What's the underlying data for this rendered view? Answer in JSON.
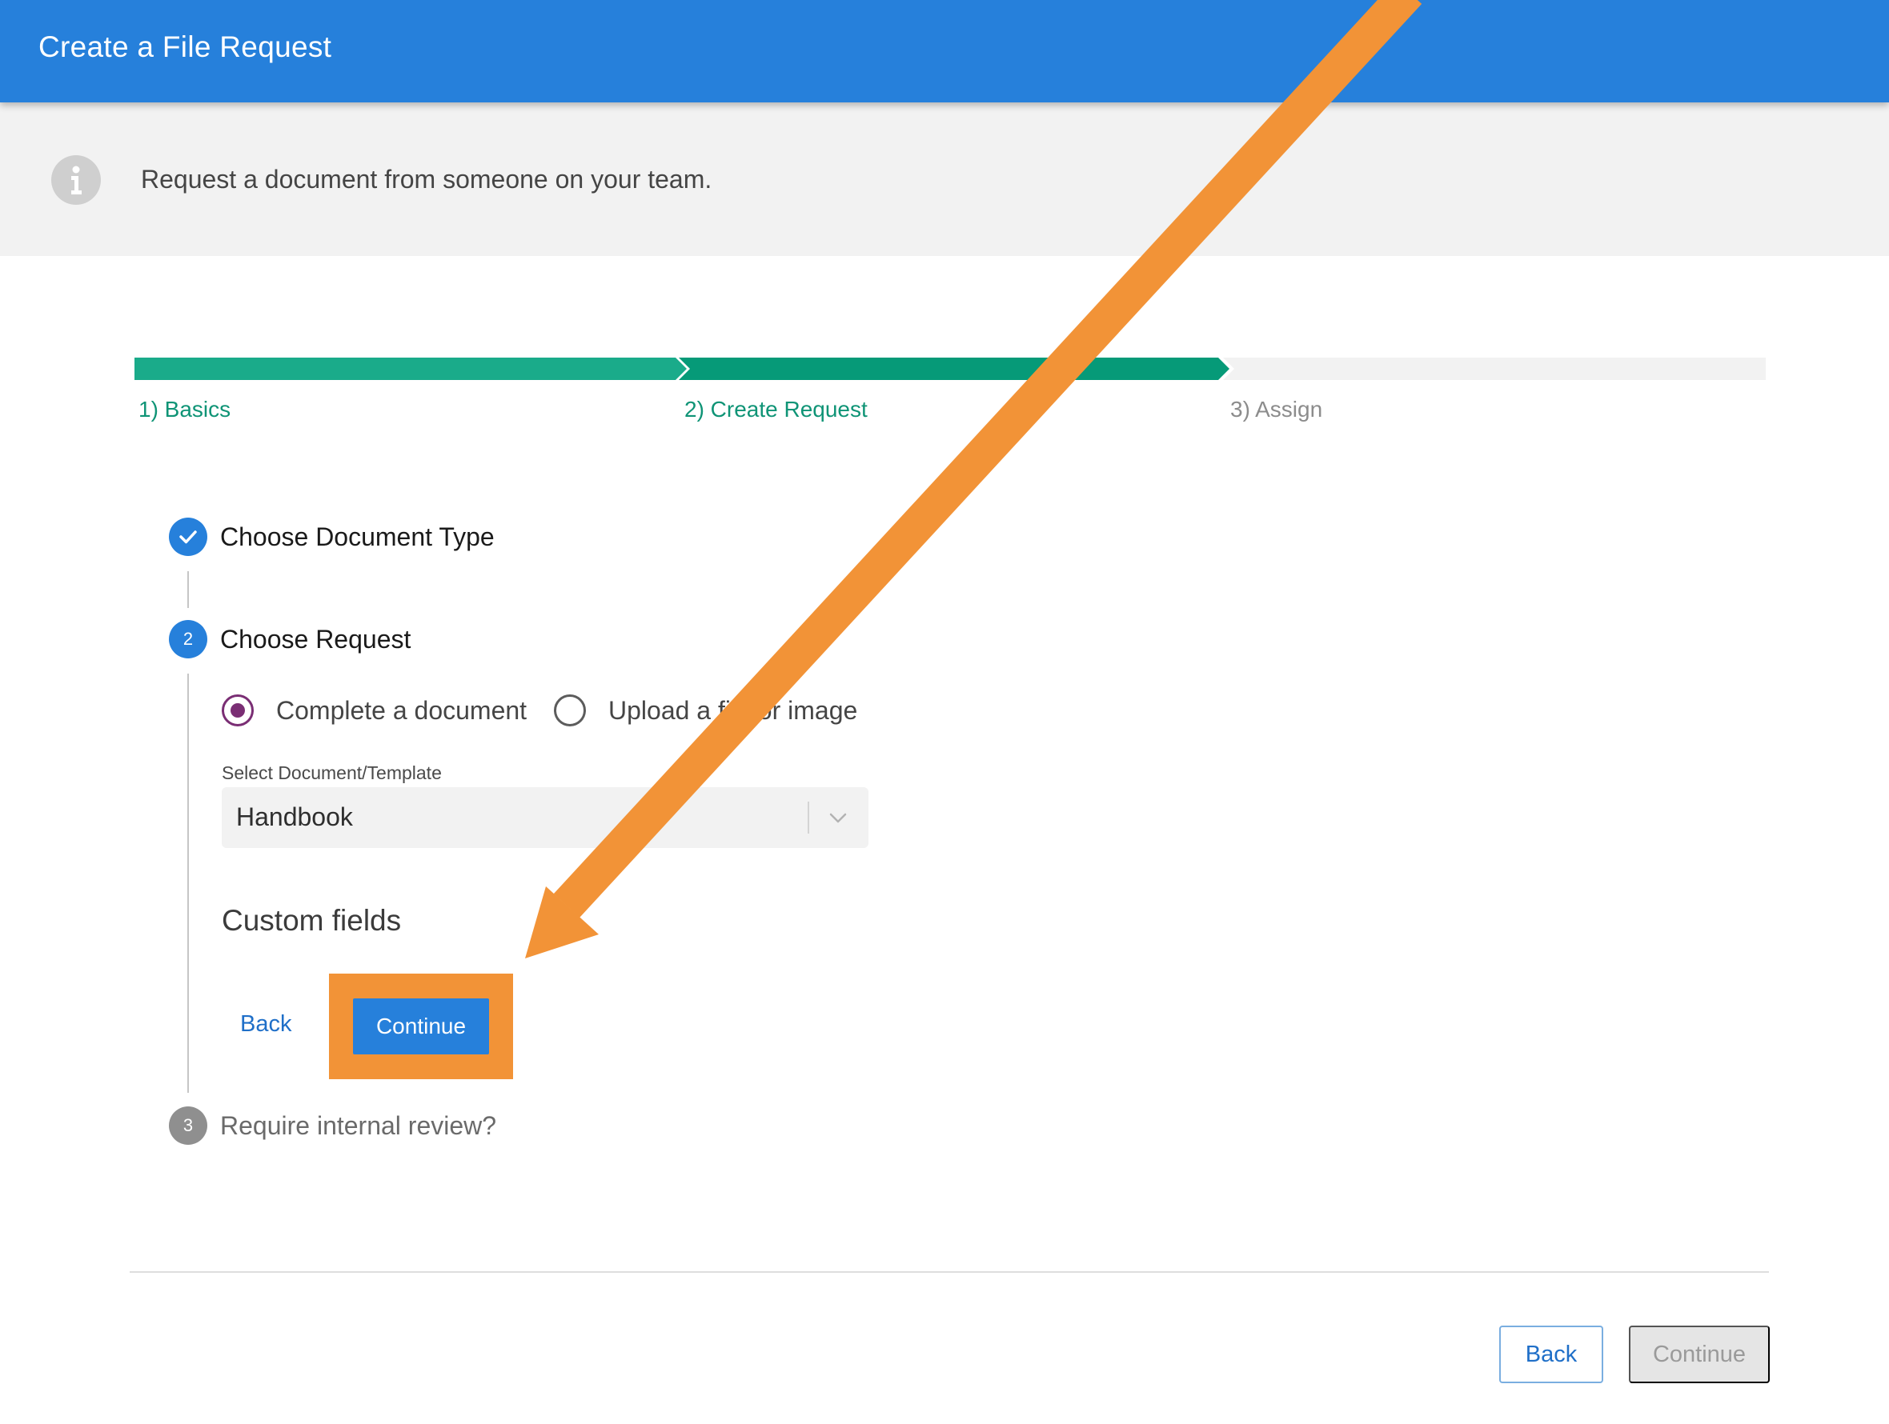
{
  "header": {
    "title": "Create a File Request"
  },
  "banner": {
    "icon": "info-icon",
    "text": "Request a document from someone on your team."
  },
  "progress": {
    "steps": [
      {
        "label": "1) Basics",
        "state": "complete"
      },
      {
        "label": "2) Create Request",
        "state": "current"
      },
      {
        "label": "3) Assign",
        "state": "upcoming"
      }
    ]
  },
  "stepper": {
    "step1": {
      "title": "Choose Document Type",
      "icon": "check-icon"
    },
    "step2": {
      "number": "2",
      "title": "Choose Request"
    },
    "step3": {
      "number": "3",
      "title": "Require internal review?"
    }
  },
  "request_type": {
    "options": [
      {
        "label": "Complete a document",
        "checked": true
      },
      {
        "label": "Upload a file or image",
        "checked": false
      }
    ]
  },
  "document_select": {
    "label": "Select Document/Template",
    "value": "Handbook"
  },
  "custom_fields": {
    "heading": "Custom fields"
  },
  "inline_actions": {
    "back": "Back",
    "continue": "Continue"
  },
  "footer": {
    "back": "Back",
    "continue": "Continue"
  },
  "colors": {
    "header": "#2680db",
    "progress_complete": "#1aab8a",
    "progress_current": "#069a78",
    "radio_checked": "#7a2e74",
    "annotation": "#f29337"
  }
}
